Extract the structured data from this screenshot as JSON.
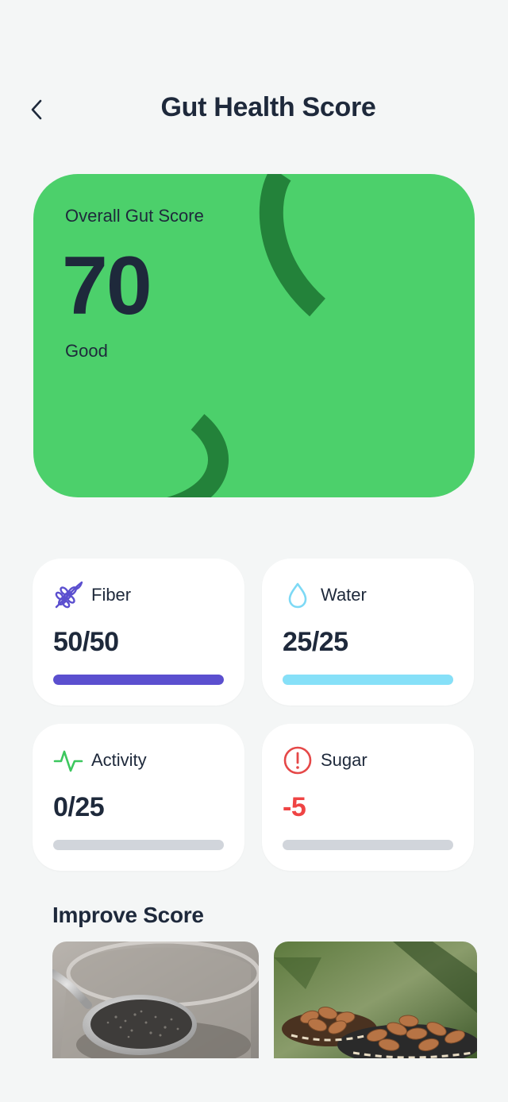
{
  "header": {
    "title": "Gut Health Score"
  },
  "score_card": {
    "label": "Overall Gut Score",
    "value": "70",
    "status": "Good",
    "background_color": "#4cd06b",
    "arc_color": "#23823a"
  },
  "metrics": [
    {
      "name": "Fiber",
      "value": "50/50",
      "icon": "wheat-icon",
      "icon_color": "#5b4fcf",
      "bar_color": "#5b4fcf",
      "progress": 1.0,
      "negative": false
    },
    {
      "name": "Water",
      "value": "25/25",
      "icon": "water-drop-icon",
      "icon_color": "#7dd9f5",
      "bar_color": "#86e0f8",
      "progress": 1.0,
      "negative": false
    },
    {
      "name": "Activity",
      "value": "0/25",
      "icon": "activity-pulse-icon",
      "icon_color": "#3cc75e",
      "bar_color": "#d1d5db",
      "progress": 0.0,
      "negative": false
    },
    {
      "name": "Sugar",
      "value": "-5",
      "icon": "alert-circle-icon",
      "icon_color": "#e54848",
      "bar_color": "#d1d5db",
      "progress": 0.0,
      "negative": true
    }
  ],
  "improve": {
    "title": "Improve Score",
    "items": [
      {
        "name": "chia-seeds-image"
      },
      {
        "name": "almonds-image"
      }
    ]
  }
}
